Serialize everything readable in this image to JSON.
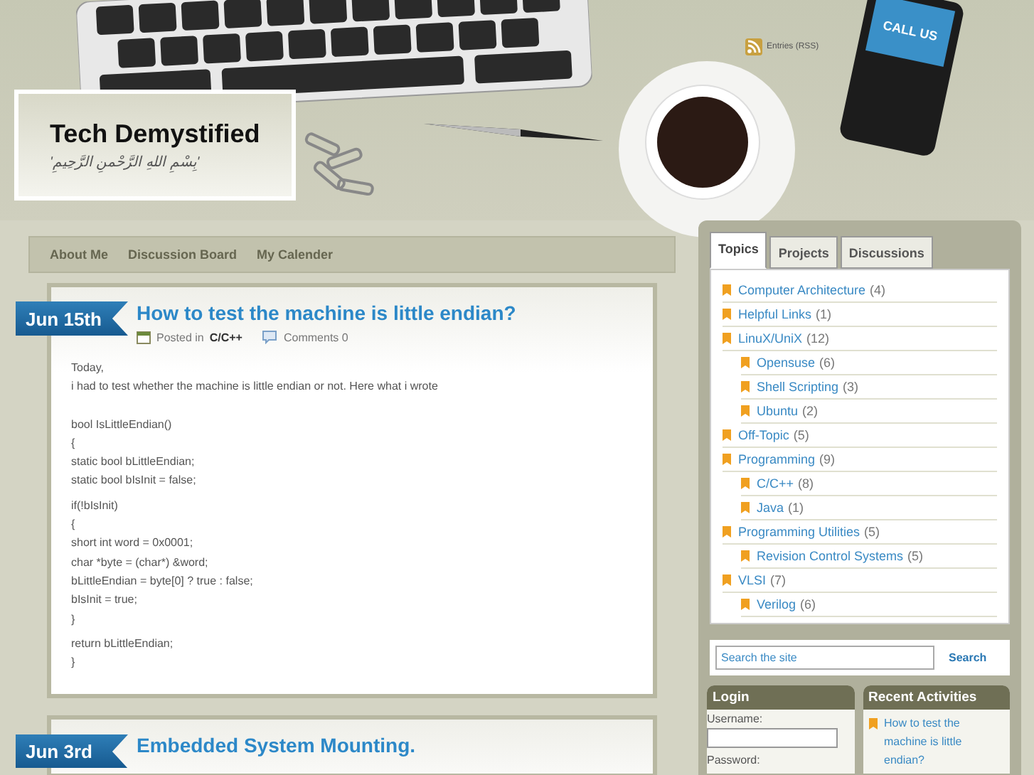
{
  "header": {
    "title": "Tech Demystified",
    "tagline": "'بِسْمِ اللهِ الرَّحْمنِ الرَّحِيمِ'",
    "rss": "Entries (RSS)",
    "phone_screen": "CALL US"
  },
  "nav": [
    "About Me",
    "Discussion Board",
    "My Calender"
  ],
  "posts": [
    {
      "date": "Jun 15th",
      "title": "How to test the machine is little endian?",
      "posted_in": "Posted in",
      "category": "C/C++",
      "comments": "Comments 0",
      "body": [
        [
          "Today,",
          "i had to test whether the machine is little endian or not. Here what i wrote"
        ],
        [
          "bool IsLittleEndian()",
          "{",
          "static bool bLittleEndian;",
          "static bool bIsInit = false;"
        ],
        [
          "if(!bIsInit)",
          "{",
          "short int word = 0x0001;",
          "char *byte = (char*) &word;",
          "bLittleEndian = byte[0] ? true : false;",
          "bIsInit = true;",
          "}"
        ],
        [
          "return bLittleEndian;",
          "}"
        ]
      ]
    },
    {
      "date": "Jun 3rd",
      "title": "Embedded System Mounting."
    }
  ],
  "sidebar": {
    "tabs": [
      {
        "label": "Topics",
        "selected": true
      },
      {
        "label": "Projects",
        "selected": false
      },
      {
        "label": "Discussions",
        "selected": false
      }
    ],
    "topics": [
      {
        "name": "Computer Architecture",
        "count": "(4)"
      },
      {
        "name": "Helpful Links",
        "count": "(1)"
      },
      {
        "name": "LinuX/UniX",
        "count": "(12)",
        "children": [
          {
            "name": "Opensuse",
            "count": "(6)"
          },
          {
            "name": "Shell Scripting",
            "count": "(3)"
          },
          {
            "name": "Ubuntu",
            "count": "(2)"
          }
        ]
      },
      {
        "name": "Off-Topic",
        "count": "(5)"
      },
      {
        "name": "Programming",
        "count": "(9)",
        "children": [
          {
            "name": "C/C++",
            "count": "(8)"
          },
          {
            "name": "Java",
            "count": "(1)"
          }
        ]
      },
      {
        "name": "Programming Utilities",
        "count": "(5)",
        "children": [
          {
            "name": "Revision Control Systems",
            "count": "(5)"
          }
        ]
      },
      {
        "name": "VLSI",
        "count": "(7)",
        "children": [
          {
            "name": "Verilog",
            "count": "(6)"
          }
        ]
      }
    ],
    "search": {
      "placeholder": "Search the site",
      "button": "Search"
    },
    "login": {
      "title": "Login",
      "username_label": "Username:",
      "password_label": "Password:"
    },
    "recent": {
      "title": "Recent Activities",
      "items": [
        "How to test the machine is little endian?"
      ]
    }
  }
}
